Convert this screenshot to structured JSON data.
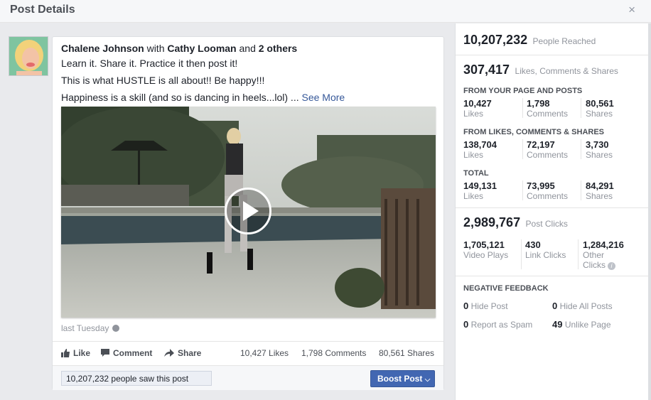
{
  "dialog": {
    "title": "Post Details",
    "close_glyph": "×"
  },
  "post": {
    "author": "Chalene Johnson",
    "with_word": "with",
    "tagged": "Cathy Looman",
    "and_word": "and",
    "others": "2 others",
    "lines": [
      "Learn it. Share it. Practice it then post it!",
      "This is what HUSTLE is all about!! Be happy!!!",
      "Happiness is a skill (and so is dancing in heels...lol) ..."
    ],
    "see_more": "See More",
    "timestamp": "last Tuesday",
    "actions": {
      "like": "Like",
      "comment": "Comment",
      "share": "Share"
    },
    "stats": {
      "likes": "10,427 Likes",
      "comments": "1,798 Comments",
      "shares": "80,561 Shares"
    },
    "reach_text": "10,207,232 people saw this post",
    "boost_label": "Boost Post",
    "boost_caret": "⌵"
  },
  "insights": {
    "reached": {
      "value": "10,207,232",
      "label": "People Reached"
    },
    "engagement": {
      "value": "307,417",
      "label": "Likes, Comments & Shares"
    },
    "sections": [
      {
        "title": "FROM YOUR PAGE AND POSTS",
        "cells": [
          {
            "value": "10,427",
            "label": "Likes"
          },
          {
            "value": "1,798",
            "label": "Comments"
          },
          {
            "value": "80,561",
            "label": "Shares"
          }
        ]
      },
      {
        "title": "FROM LIKES, COMMENTS & SHARES",
        "cells": [
          {
            "value": "138,704",
            "label": "Likes"
          },
          {
            "value": "72,197",
            "label": "Comments"
          },
          {
            "value": "3,730",
            "label": "Shares"
          }
        ]
      },
      {
        "title": "TOTAL",
        "cells": [
          {
            "value": "149,131",
            "label": "Likes"
          },
          {
            "value": "73,995",
            "label": "Comments"
          },
          {
            "value": "84,291",
            "label": "Shares"
          }
        ]
      }
    ],
    "clicks": {
      "value": "2,989,767",
      "label": "Post Clicks"
    },
    "click_cells": [
      {
        "value": "1,705,121",
        "label": "Video Plays"
      },
      {
        "value": "430",
        "label": "Link Clicks"
      },
      {
        "value": "1,284,216",
        "label": "Other",
        "label2": "Clicks"
      }
    ],
    "info_glyph": "i",
    "negative": {
      "title": "NEGATIVE FEEDBACK",
      "items": [
        {
          "value": "0",
          "label": "Hide Post"
        },
        {
          "value": "0",
          "label": "Hide All Posts"
        },
        {
          "value": "0",
          "label": "Report as Spam"
        },
        {
          "value": "49",
          "label": "Unlike Page"
        }
      ]
    }
  },
  "colors": {
    "link": "#365899",
    "boost": "#4267b2",
    "muted": "#90949c"
  }
}
